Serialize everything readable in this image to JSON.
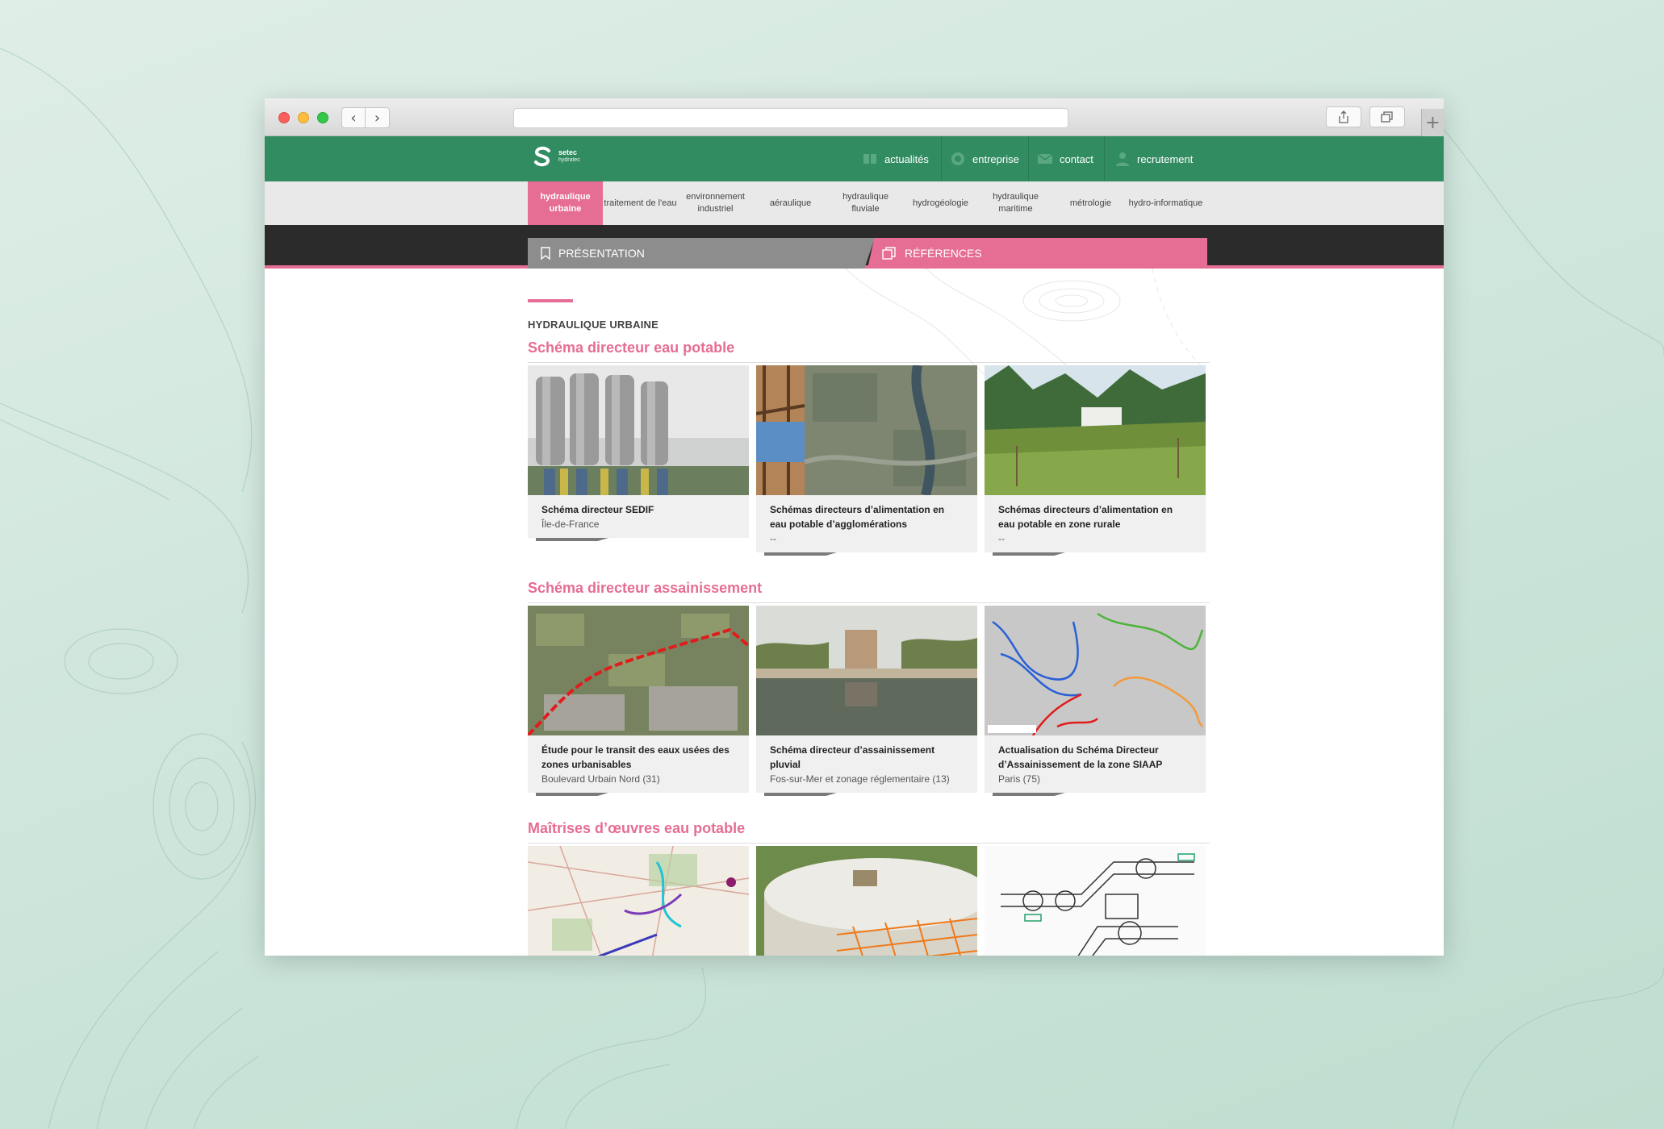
{
  "brand": {
    "name": "setec",
    "tagline": "hydratec"
  },
  "topnav": [
    {
      "label": "actualités",
      "icon": "news-icon"
    },
    {
      "label": "entreprise",
      "icon": "globe-icon"
    },
    {
      "label": "contact",
      "icon": "mail-icon"
    },
    {
      "label": "recrutement",
      "icon": "user-icon"
    }
  ],
  "categories": [
    {
      "label": "hydraulique urbaine",
      "active": true
    },
    {
      "label": "traitement de l'eau",
      "active": false
    },
    {
      "label": "environnement industriel",
      "active": false
    },
    {
      "label": "aéraulique",
      "active": false
    },
    {
      "label": "hydraulique fluviale",
      "active": false
    },
    {
      "label": "hydrogéologie",
      "active": false
    },
    {
      "label": "hydraulique maritime",
      "active": false
    },
    {
      "label": "métrologie",
      "active": false
    },
    {
      "label": "hydro-informatique",
      "active": false
    }
  ],
  "tabs": {
    "presentation": "PRÉSENTATION",
    "references": "RÉFÉRENCES"
  },
  "page": {
    "category_title": "HYDRAULIQUE URBAINE"
  },
  "sections": [
    {
      "title": "Schéma directeur eau potable",
      "cards": [
        {
          "title": "Schéma directeur SEDIF",
          "subtitle": "Île-de-France",
          "image": "water-towers-photo"
        },
        {
          "title": "Schémas directeurs d’alimentation en eau potable d’agglomérations",
          "subtitle": "--",
          "image": "aerial-city-photo"
        },
        {
          "title": "Schémas directeurs d’alimentation en eau potable en zone rurale",
          "subtitle": "--",
          "image": "rural-reservoir-photo"
        }
      ]
    },
    {
      "title": "Schéma directeur assainissement",
      "cards": [
        {
          "title": "Étude pour le transit des eaux usées des zones urbanisables",
          "subtitle": "Boulevard Urbain Nord (31)",
          "image": "aerial-route-photo"
        },
        {
          "title": "Schéma directeur d’assainissement pluvial",
          "subtitle": "Fos-sur-Mer et zonage réglementaire (13)",
          "image": "pond-building-photo"
        },
        {
          "title": "Actualisation du Schéma Directeur d’Assainissement de la zone SIAAP",
          "subtitle": "Paris (75)",
          "image": "network-map"
        }
      ]
    },
    {
      "title": "Maîtrises d’œuvres eau potable",
      "cards": [
        {
          "title": "",
          "subtitle": "",
          "image": "topo-map"
        },
        {
          "title": "",
          "subtitle": "",
          "image": "reservoir-construction-photo"
        },
        {
          "title": "",
          "subtitle": "",
          "image": "pipe-drawing"
        }
      ]
    }
  ],
  "colors": {
    "green": "#328c62",
    "pink": "#e66d93",
    "dark": "#2b2b2b",
    "grey": "#e9e9e9"
  }
}
